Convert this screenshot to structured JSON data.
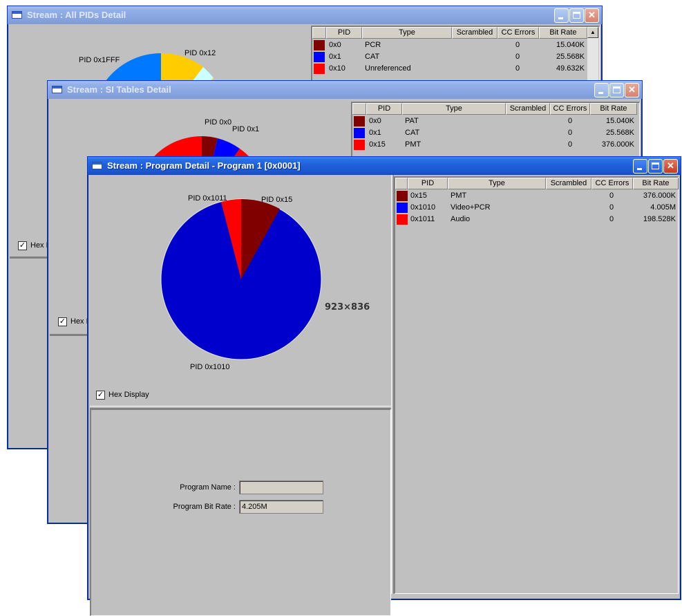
{
  "colors": {
    "dark_red": "#800000",
    "blue": "#0000ff",
    "red": "#ff0000",
    "yellow": "#ffcc00",
    "navy": "#0078ff",
    "light": "#ccffff"
  },
  "window1": {
    "title": "Stream : All PIDs Detail",
    "columns": [
      "PID",
      "Type",
      "Scrambled",
      "CC Errors",
      "Bit Rate"
    ],
    "rows": [
      {
        "pid": "0x0",
        "type": "PCR",
        "scrambled": "",
        "cc": "0",
        "rate": "15.040K",
        "color": "#800000"
      },
      {
        "pid": "0x1",
        "type": "CAT",
        "scrambled": "",
        "cc": "0",
        "rate": "25.568K",
        "color": "#0000ff"
      },
      {
        "pid": "0x10",
        "type": "Unreferenced",
        "scrambled": "",
        "cc": "0",
        "rate": "49.632K",
        "color": "#ff0000"
      }
    ],
    "pie_labels": {
      "a": "PID 0x1FFF",
      "b": "PID 0x12"
    },
    "checkbox_label": "Hex D"
  },
  "window2": {
    "title": "Stream : SI Tables Detail",
    "columns": [
      "PID",
      "Type",
      "Scrambled",
      "CC Errors",
      "Bit Rate"
    ],
    "rows": [
      {
        "pid": "0x0",
        "type": "PAT",
        "scrambled": "",
        "cc": "0",
        "rate": "15.040K",
        "color": "#800000"
      },
      {
        "pid": "0x1",
        "type": "CAT",
        "scrambled": "",
        "cc": "0",
        "rate": "25.568K",
        "color": "#0000ff"
      },
      {
        "pid": "0x15",
        "type": "PMT",
        "scrambled": "",
        "cc": "0",
        "rate": "376.000K",
        "color": "#ff0000"
      }
    ],
    "pie_labels": {
      "a": "PID 0x0",
      "b": "PID 0x1"
    },
    "checkbox_label": "Hex D"
  },
  "window3": {
    "title": "Stream : Program Detail - Program 1 [0x0001]",
    "columns": [
      "PID",
      "Type",
      "Scrambled",
      "CC Errors",
      "Bit Rate"
    ],
    "rows": [
      {
        "pid": "0x15",
        "type": "PMT",
        "scrambled": "",
        "cc": "0",
        "rate": "376.000K",
        "color": "#800000"
      },
      {
        "pid": "0x1010",
        "type": "Video+PCR",
        "scrambled": "",
        "cc": "0",
        "rate": "4.005M",
        "color": "#0000ff"
      },
      {
        "pid": "0x1011",
        "type": "Audio",
        "scrambled": "",
        "cc": "0",
        "rate": "198.528K",
        "color": "#ff0000"
      }
    ],
    "pie_labels": {
      "a": "PID 0x1011",
      "b": "PID 0x15",
      "c": "PID 0x1010"
    },
    "dimension_label": "923×836",
    "checkbox_label": "Hex Display",
    "program_name_label": "Program Name :",
    "program_name_value": "",
    "program_bitrate_label": "Program Bit Rate :",
    "program_bitrate_value": "4.205M"
  }
}
